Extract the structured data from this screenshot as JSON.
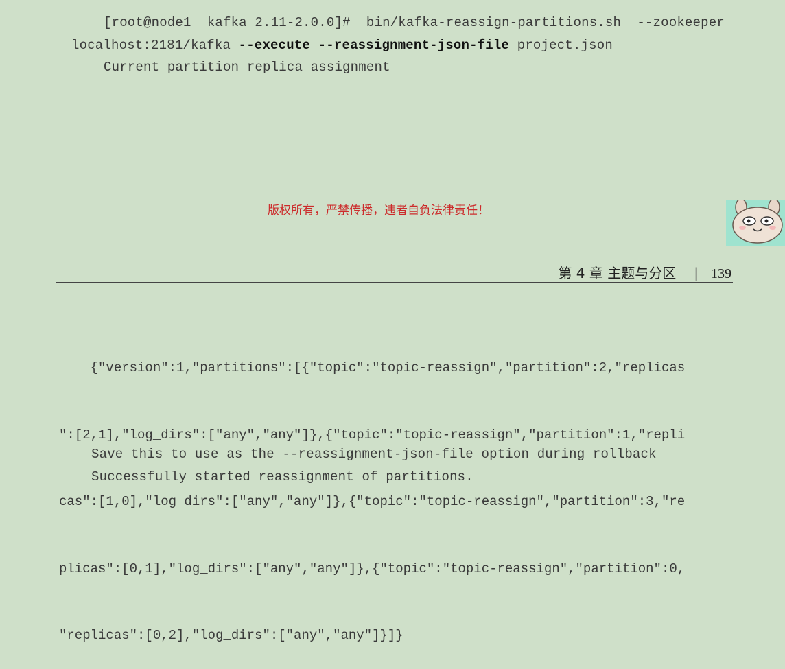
{
  "top": {
    "cmd_prefix": "[root@node1  kafka_2.11-2.0.0]#  bin/kafka-reassign-partitions.sh  --zookeeper",
    "cmd_line2_host": "localhost:2181/kafka ",
    "cmd_line2_execute": "--execute",
    "cmd_line2_space": " ",
    "cmd_line2_flag": "--reassignment-json-file",
    "cmd_line2_file": " project.json",
    "current_label": "Current partition replica assignment"
  },
  "watermark": {
    "copyright": "版权所有，严禁传播，违者自负法律责任！"
  },
  "header": {
    "chapter": "第 4 章   主题与分区",
    "separator": "|",
    "page_number": "139"
  },
  "json_lines": [
    "    {\"version\":1,\"partitions\":[{\"topic\":\"topic-reassign\",\"partition\":2,\"replicas",
    "\":[2,1],\"log_dirs\":[\"any\",\"any\"]},{\"topic\":\"topic-reassign\",\"partition\":1,\"repli",
    "cas\":[1,0],\"log_dirs\":[\"any\",\"any\"]},{\"topic\":\"topic-reassign\",\"partition\":3,\"re",
    "plicas\":[0,1],\"log_dirs\":[\"any\",\"any\"]},{\"topic\":\"topic-reassign\",\"partition\":0,",
    "\"replicas\":[0,2],\"log_dirs\":[\"any\",\"any\"]}]}"
  ],
  "bottom": {
    "save_msg": "Save this to use as the --reassignment-json-file option during rollback",
    "success_msg": "Successfully started reassignment of partitions."
  }
}
